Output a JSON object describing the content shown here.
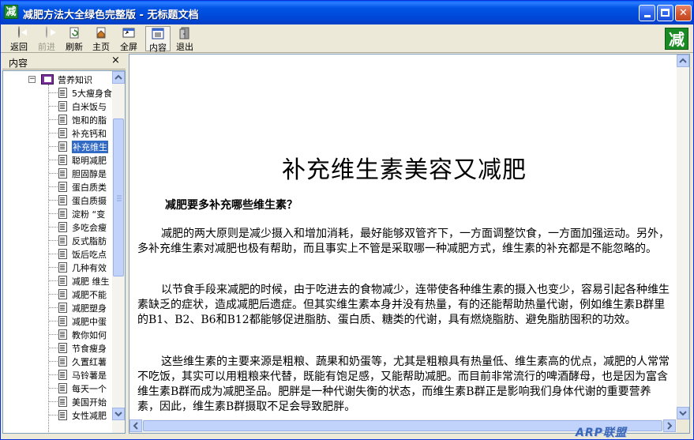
{
  "window": {
    "title": "减肥方法大全绿色完整版 - 无标题文档",
    "app_icon_char": "减",
    "colors": {
      "titlebar": "#0055e5",
      "selection": "#316ac5",
      "brand": "#1a8a25"
    }
  },
  "toolbar": {
    "back": "返回",
    "forward": "前进",
    "refresh": "刷新",
    "home": "主页",
    "fullscreen": "全屏",
    "contents": "内容",
    "exit": "退出",
    "brand_char": "减"
  },
  "sidebar": {
    "title": "内容",
    "close": "×",
    "root": {
      "label": "营养知识",
      "expander": "−"
    },
    "items": [
      "5大瘦身食",
      "白米饭与",
      "饱和的脂",
      "补充钙和",
      "补充维生",
      "聪明减肥",
      "胆固醇是",
      "蛋白质类",
      "蛋白质摄",
      "淀粉 “变",
      "多吃会瘦",
      "反式脂肪",
      "饭后吃点",
      "几种有效",
      "减肥 维生",
      "减肥不能",
      "减肥塑身",
      "减肥中蛋",
      "教你如何",
      "节食瘦身",
      "久置红薯",
      "马铃薯是",
      "每天一个",
      "美国开始",
      "女性减肥"
    ],
    "selected_index": 4
  },
  "article": {
    "title": "补充维生素美容又减肥",
    "subtitle": "减肥要多补充哪些维生素？",
    "paragraphs": [
      "减肥的两大原则是减少摄入和增加消耗，最好能够双管齐下，一方面调整饮食，一方面加强运动。另外，多补充维生素对减肥也极有帮助，而且事实上不管是采取哪一种减肥方式，维生素的补充都是不能忽略的。",
      "以节食手段来减肥的时候，由于吃进去的食物减少，连带使各种维生素的摄入也变少，容易引起各种维生素缺乏的症状，造成减肥后遗症。但其实维生素本身并没有热量，有的还能帮助热量代谢，例如维生素B群里的B1、B2、B6和B12都能够促进脂肪、蛋白质、糖类的代谢，具有燃烧脂肪、避免脂肪囤积的功效。",
      "这些维生素的主要来源是粗粮、蔬果和奶蛋等，尤其是粗粮具有热量低、维生素高的优点，减肥的人常常不吃饭，其实可以用粗粮来代替，既能有饱足感，又能帮助减肥。而目前非常流行的啤酒酵母，也是因为富含维生素B群而成为减肥圣品。肥胖是一种代谢失衡的状态，而维生素B群正是影响我们身体代谢的重要营养素，因此，维生素B群摄取不足会导致肥胖。"
    ]
  },
  "watermark": "ARP联盟"
}
